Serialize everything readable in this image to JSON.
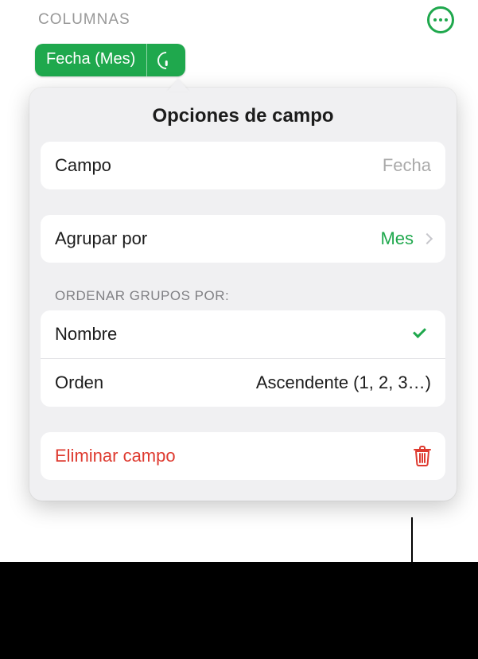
{
  "header": {
    "title": "COLUMNAS"
  },
  "pill": {
    "label": "Fecha (Mes)"
  },
  "popover": {
    "title": "Opciones de campo",
    "field_row": {
      "label": "Campo",
      "value": "Fecha"
    },
    "group_by_row": {
      "label": "Agrupar por",
      "value": "Mes"
    },
    "sort_section_label": "ORDENAR GRUPOS POR:",
    "sort_name_row": {
      "label": "Nombre"
    },
    "sort_order_row": {
      "label": "Orden",
      "value": "Ascendente (1, 2, 3…)"
    },
    "delete_row": {
      "label": "Eliminar campo"
    }
  }
}
